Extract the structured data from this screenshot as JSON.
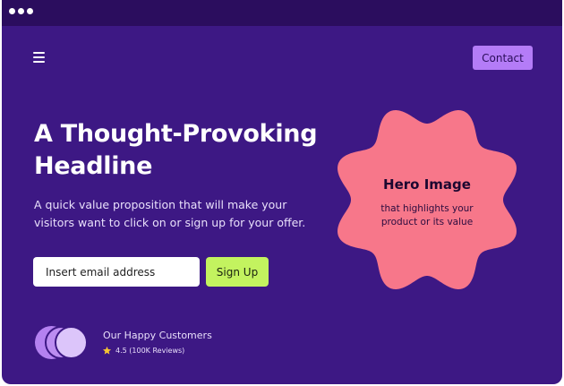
{
  "window": {
    "background": "#3d1884",
    "titlebar_color": "#2b0d5e",
    "controls": [
      "window-dot",
      "window-dot",
      "window-dot"
    ]
  },
  "nav": {
    "menu_icon": "hamburger-menu-icon",
    "contact_label": "Contact",
    "contact_color": "#b47cf7"
  },
  "hero": {
    "headline": "A Thought-Provoking Headline",
    "subtext": "A quick value proposition that will make your visitors want to click on or sign up for your offer.",
    "email_placeholder": "Insert email address",
    "signup_label": "Sign Up",
    "signup_color": "#c3f35f"
  },
  "social_proof": {
    "label": "Our Happy Customers",
    "rating_icon": "star-icon",
    "rating_text": "4.5 (100K Reviews)"
  },
  "hero_image": {
    "shape_color": "#f7778a",
    "title": "Hero Image",
    "description": "that highlights your\nproduct or its value"
  }
}
